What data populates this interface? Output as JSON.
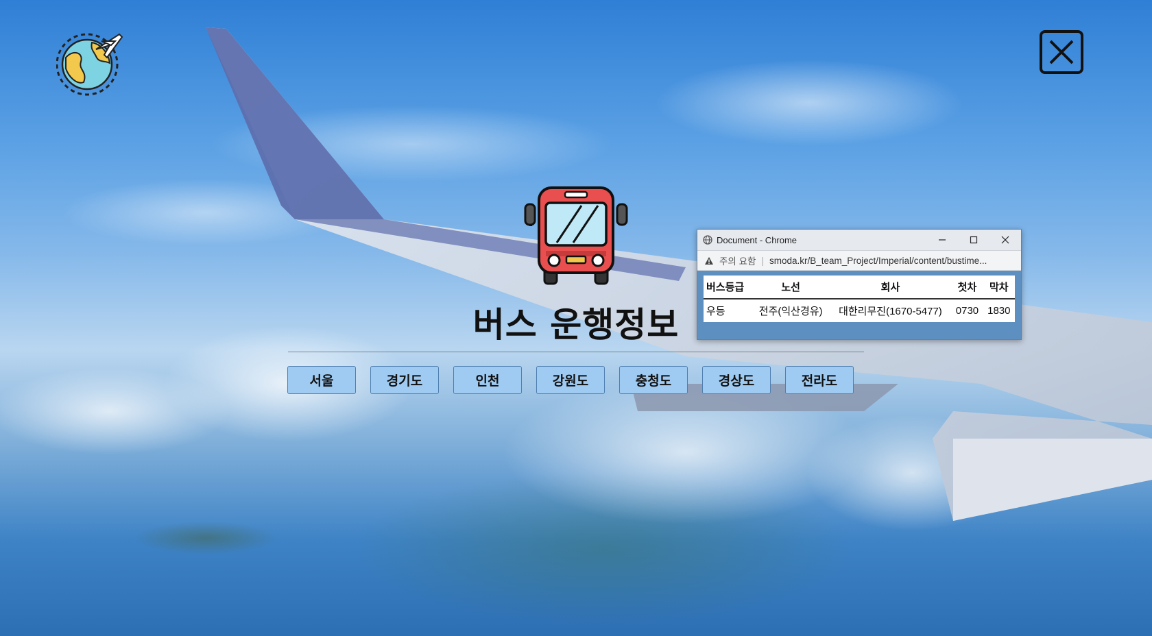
{
  "page": {
    "title": "버스 운행정보",
    "regions": [
      "서울",
      "경기도",
      "인천",
      "강원도",
      "충청도",
      "경상도",
      "전라도"
    ]
  },
  "icons": {
    "logo": "globe-airplane-icon",
    "close": "close-icon",
    "bus": "bus-icon"
  },
  "popup": {
    "window_title": "Document - Chrome",
    "security_label": "주의 요함",
    "url": "smoda.kr/B_team_Project/Imperial/content/bustime...",
    "table": {
      "headers": [
        "버스등급",
        "노선",
        "회사",
        "첫차",
        "막차"
      ],
      "rows": [
        [
          "우등",
          "전주(익산경유)",
          "대한리무진(1670-5477)",
          "0730",
          "1830"
        ]
      ]
    }
  },
  "colors": {
    "region_button": "#9fcbf2",
    "bus_red": "#e94f4f",
    "popup_frame": "#5e8fc1"
  }
}
